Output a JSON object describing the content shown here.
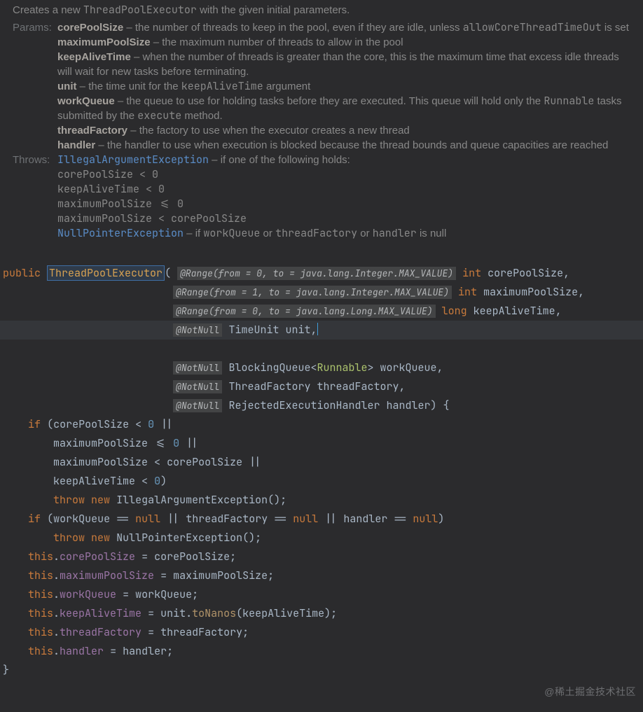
{
  "doc": {
    "desc_pre": "Creates a new ",
    "desc_code": "ThreadPoolExecutor",
    "desc_post": " with the given initial parameters.",
    "label_params": "Params:",
    "label_throws": "Throws:",
    "params": [
      {
        "name": "corePoolSize",
        "dash": " – ",
        "text_a": "the number of threads to keep in the pool, even if they are idle, unless ",
        "code": "allowCoreThreadTimeOut",
        "text_b": " is set"
      },
      {
        "name": "maximumPoolSize",
        "dash": " – ",
        "text_a": "the maximum number of threads to allow in the pool",
        "code": "",
        "text_b": ""
      },
      {
        "name": "keepAliveTime",
        "dash": " – ",
        "text_a": "when the number of threads is greater than the core, this is the maximum time that excess idle threads will wait for new tasks before terminating.",
        "code": "",
        "text_b": ""
      },
      {
        "name": "unit",
        "dash": " – ",
        "text_a": "the time unit for the ",
        "code": "keepAliveTime",
        "text_b": " argument"
      },
      {
        "name": "workQueue",
        "dash": " – ",
        "text_a": "the queue to use for holding tasks before they are executed. This queue will hold only the ",
        "code": "Runnable",
        "text_b": " tasks submitted by the ",
        "code2": "execute",
        "text_c": " method."
      },
      {
        "name": "threadFactory",
        "dash": " – ",
        "text_a": "the factory to use when the executor creates a new thread",
        "code": "",
        "text_b": ""
      },
      {
        "name": "handler",
        "dash": " – ",
        "text_a": "the handler to use when execution is blocked because the thread bounds and queue capacities are reached",
        "code": "",
        "text_b": ""
      }
    ],
    "throws": {
      "ex1": {
        "name": "IllegalArgumentException",
        "dash": " – ",
        "desc": "if one of the following holds:"
      },
      "conds": [
        "corePoolSize < 0",
        "keepAliveTime < 0",
        "maximumPoolSize <= 0",
        "maximumPoolSize < corePoolSize"
      ],
      "ex2": {
        "name": "NullPointerException",
        "dash": " – ",
        "desc_a": "if ",
        "c1": "workQueue",
        "or1": " or ",
        "c2": "threadFactory",
        "or2": " or ",
        "c3": "handler",
        "desc_b": " is null"
      }
    }
  },
  "sig": {
    "kw_public": "public",
    "ctor": "ThreadPoolExecutor",
    "paren_open": "(",
    "ann_rangeIntFrom0": "@Range(from = 0, to = java.lang.Integer.MAX_VALUE)",
    "type_int": "int",
    "p1": "corePoolSize",
    "comma": ",",
    "ann_rangeIntFrom1": "@Range(from = 1, to = java.lang.Integer.MAX_VALUE)",
    "p2": "maximumPoolSize",
    "ann_rangeLongFrom0": "@Range(from = 0, to = java.lang.Long.MAX_VALUE)",
    "type_long": "long",
    "p3": "keepAliveTime",
    "ann_notnull": "@NotNull",
    "type_timeunit": "TimeUnit",
    "p4": "unit",
    "type_bq": "BlockingQueue",
    "lt": "<",
    "gt": ">",
    "type_runnable": "Runnable",
    "p5": "workQueue",
    "type_tf": "ThreadFactory",
    "p6": "threadFactory",
    "type_reh": "RejectedExecutionHandler",
    "p7": "handler",
    "paren_close_brace": ") {"
  },
  "body": {
    "if": "if",
    "throw": "throw",
    "new": "new",
    "this": "this",
    "zero": "0",
    "null": "null",
    "lt": "<",
    "lte": "<=",
    "eq": "==",
    "or": "||",
    "dot": ".",
    "assign": " = ",
    "semi": ";",
    "open": "(",
    "close": ")",
    "close_brace": "}",
    "ex_iae": "IllegalArgumentException",
    "ex_npe": "NullPointerException",
    "m_toNanos": "toNanos",
    "f_corePoolSize": "corePoolSize",
    "f_maximumPoolSize": "maximumPoolSize",
    "f_workQueue": "workQueue",
    "f_keepAliveTime": "keepAliveTime",
    "f_threadFactory": "threadFactory",
    "f_handler": "handler",
    "v_unit": "unit"
  },
  "watermark": "@稀土掘金技术社区"
}
